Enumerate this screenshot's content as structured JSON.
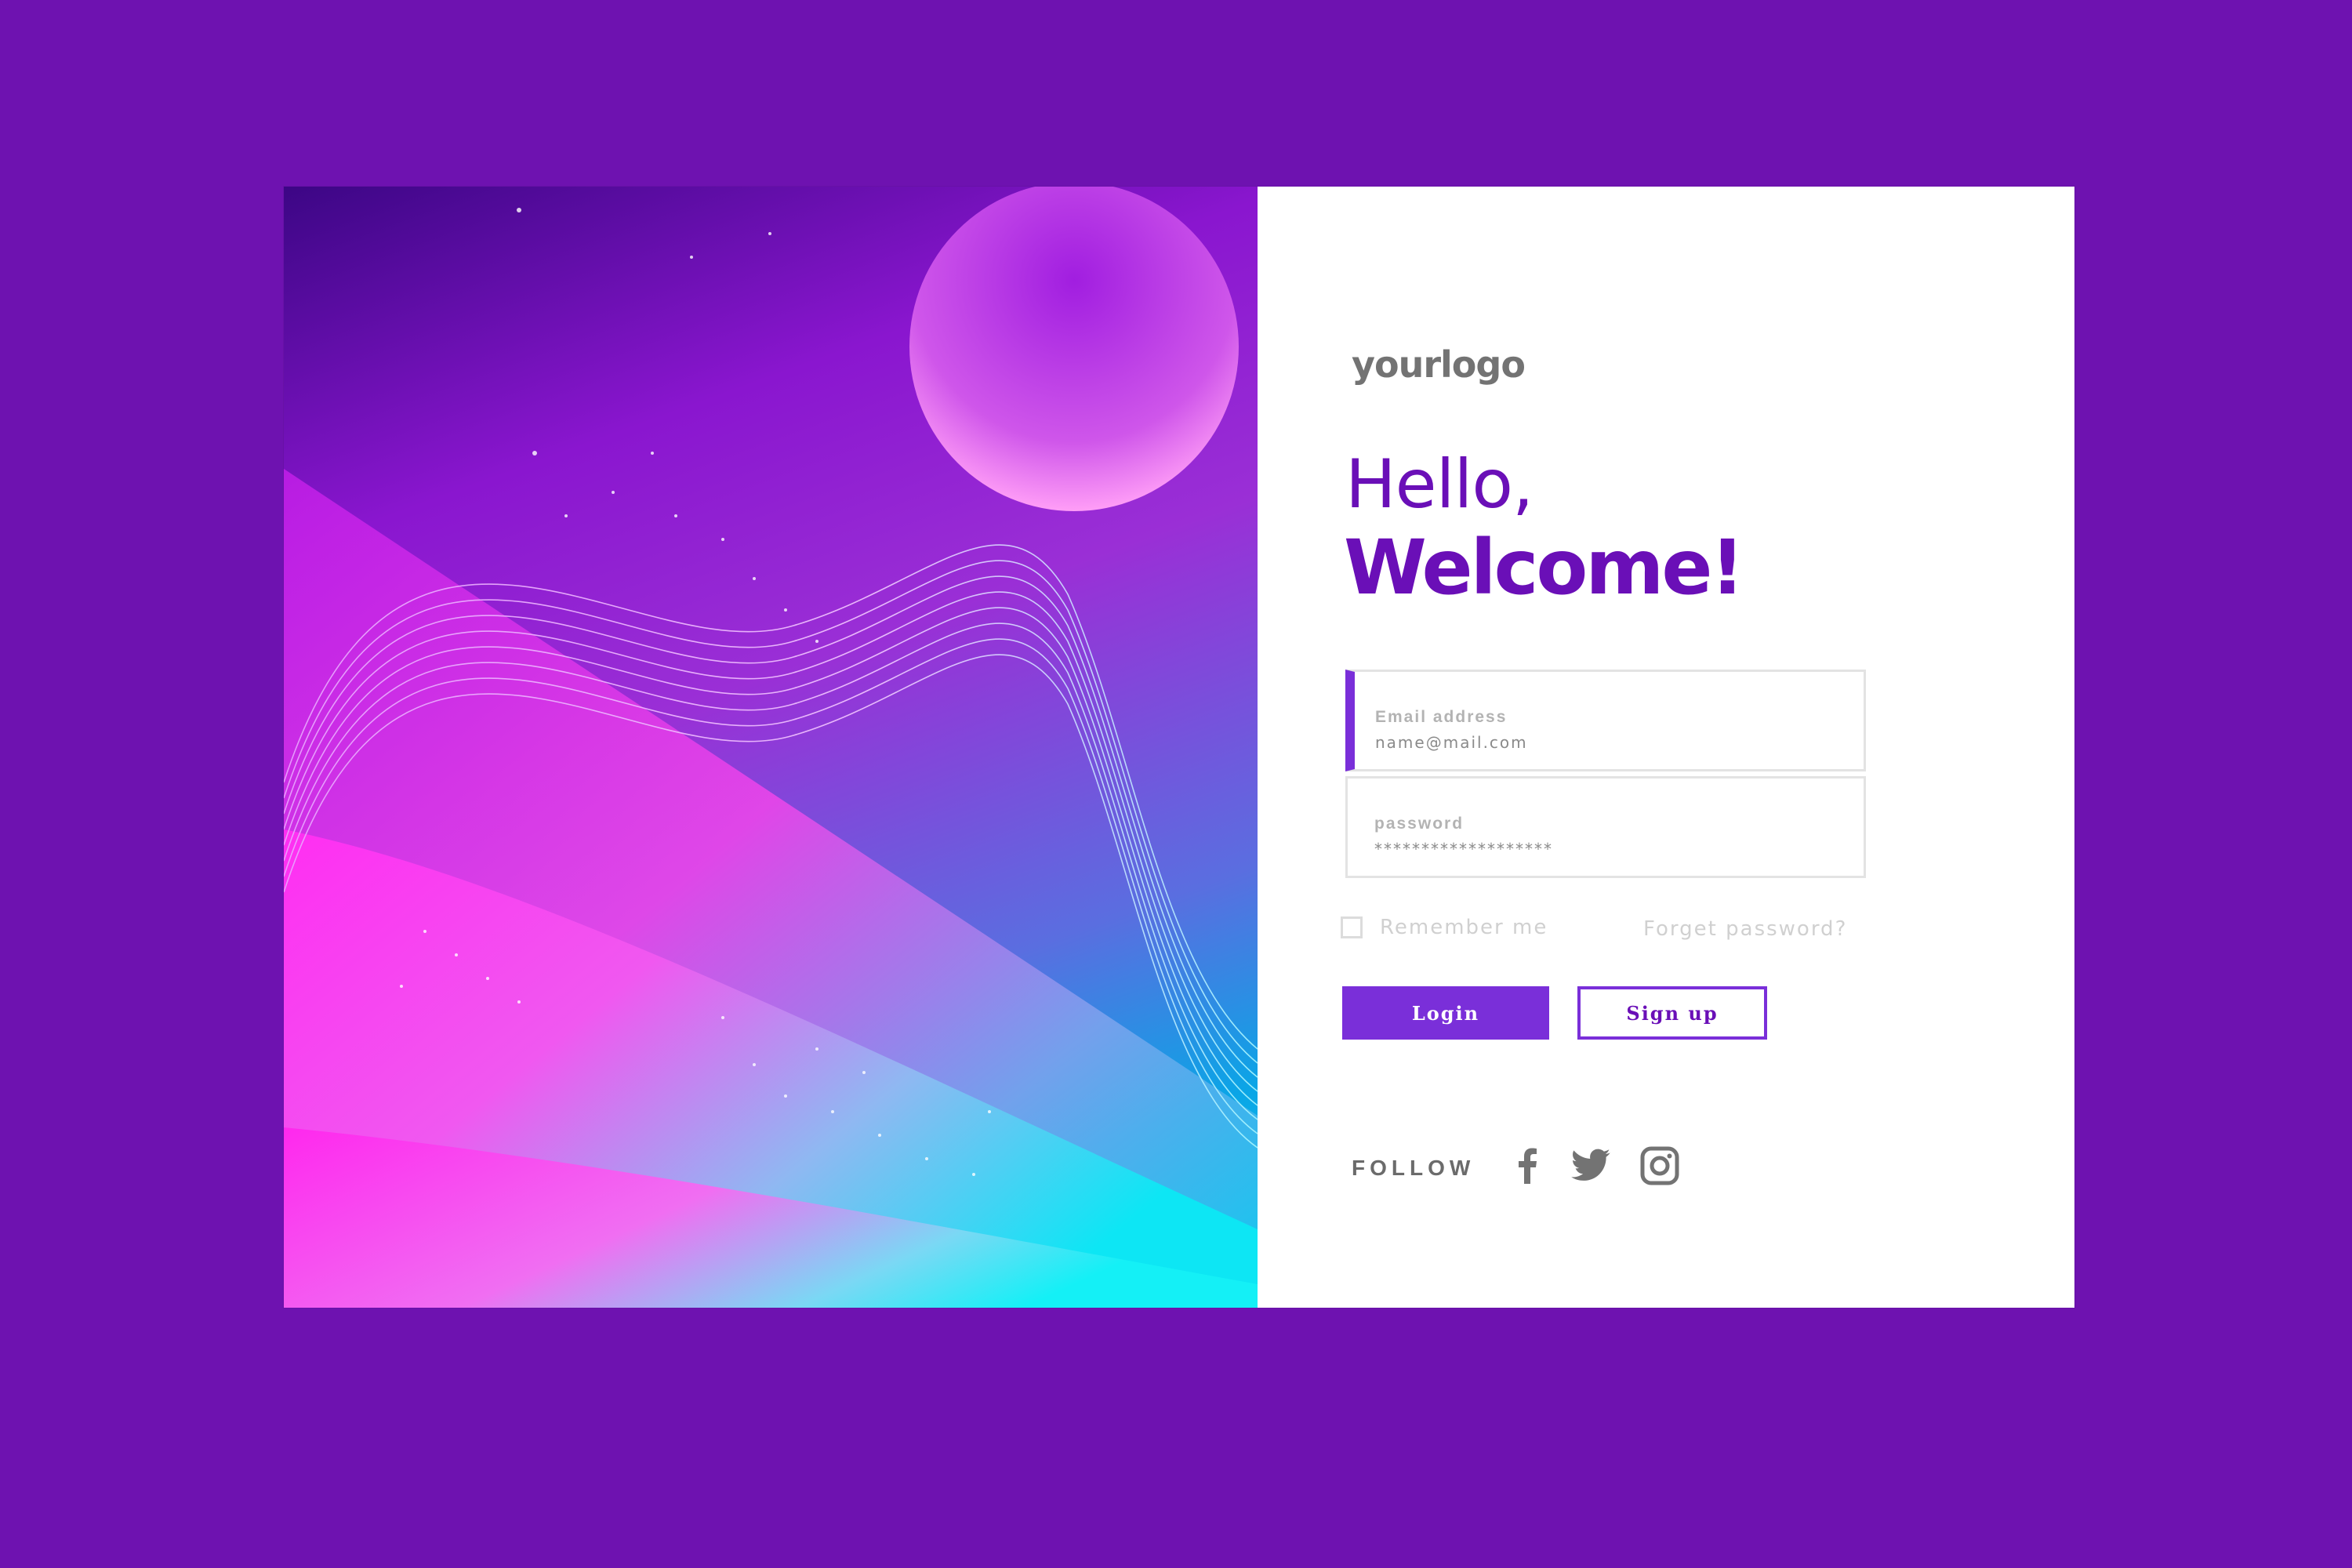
{
  "brand": {
    "logo_text": "yourlogo"
  },
  "greeting": {
    "line1": "Hello,",
    "line2": "Welcome!"
  },
  "form": {
    "email_label": "Email address",
    "email_value": "name@mail.com",
    "password_label": "password",
    "password_value": "*******************",
    "remember_label": "Remember me",
    "forgot_label": "Forget password?",
    "login_label": "Login",
    "signup_label": "Sign up"
  },
  "footer": {
    "follow_label": "FOLLOW",
    "social_icons": [
      "facebook-icon",
      "twitter-icon",
      "instagram-icon"
    ]
  },
  "colors": {
    "page_background": "#6e12b0",
    "accent_purple": "#7a2fd9",
    "heading_purple": "#6a0fb7",
    "icon_gray": "#737373"
  }
}
